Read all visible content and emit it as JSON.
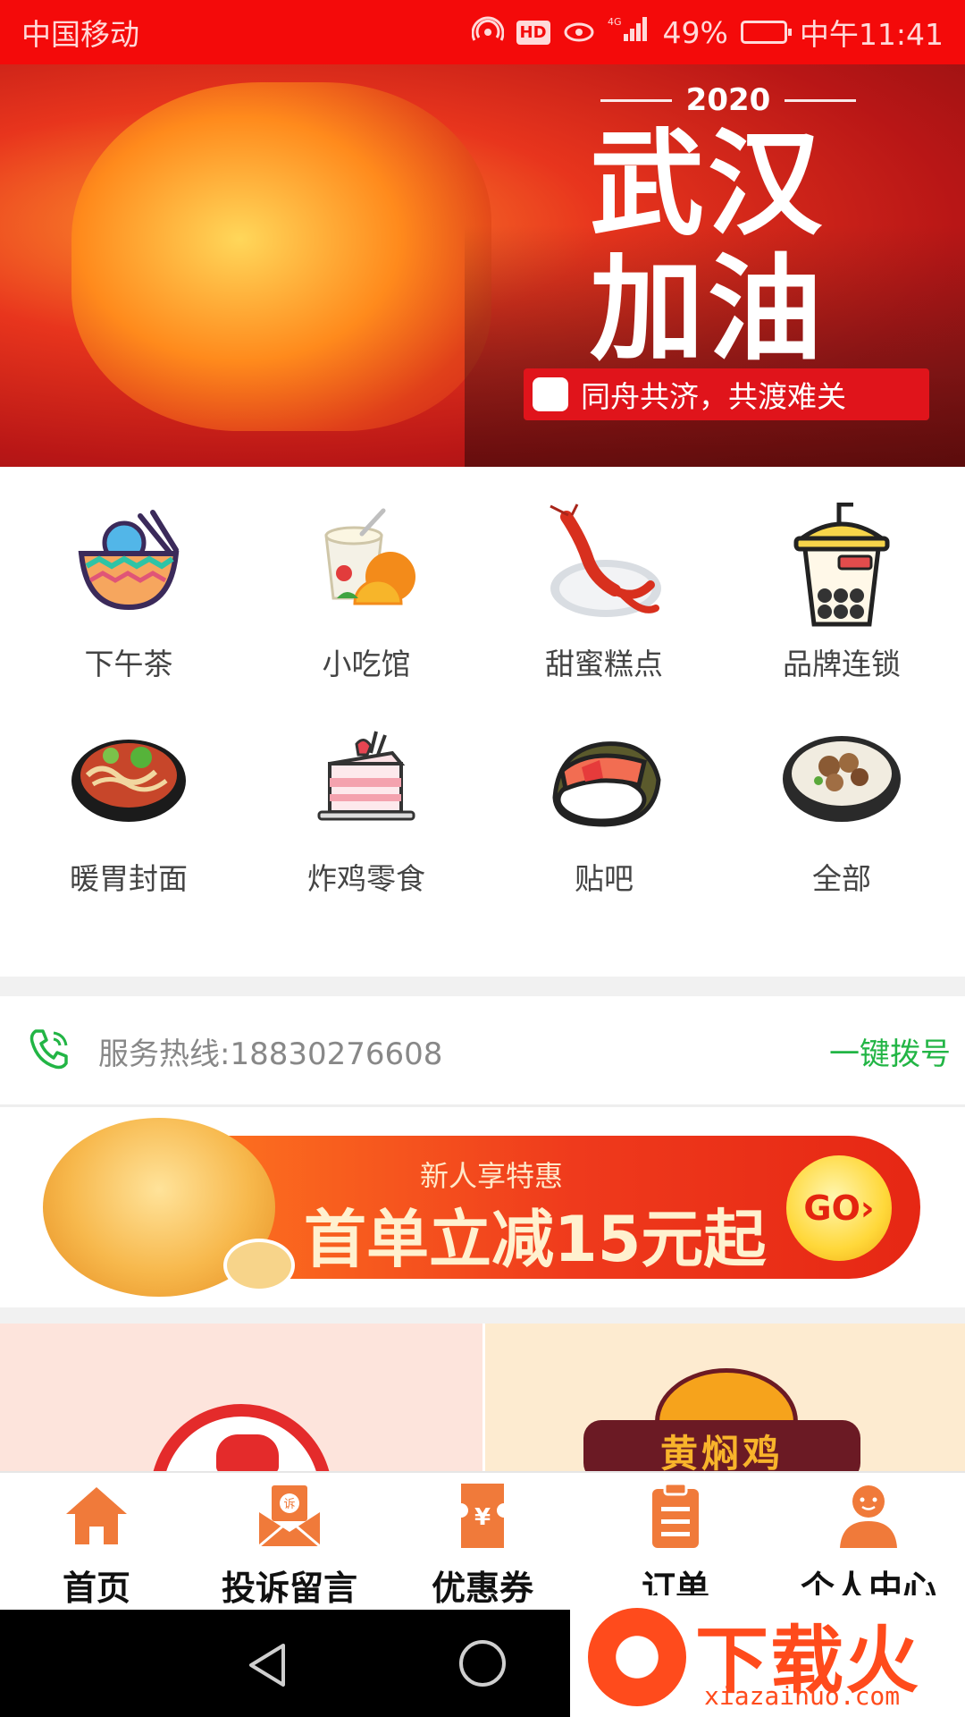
{
  "status_bar": {
    "carrier": "中国移动",
    "hd": "HD",
    "network": "4G",
    "battery": "49%",
    "time": "中午11:41"
  },
  "banner": {
    "year": "2020",
    "title_line1": "武汉",
    "title_line2": "加油",
    "slogan": "同舟共济，共渡难关",
    "slides": 3,
    "active_slide": 1
  },
  "categories": [
    {
      "label": "下午茶",
      "icon": "bowl-icon"
    },
    {
      "label": "小吃馆",
      "icon": "yogurt-icon"
    },
    {
      "label": "甜蜜糕点",
      "icon": "lobster-icon"
    },
    {
      "label": "品牌连锁",
      "icon": "bubble-tea-icon"
    },
    {
      "label": "暖胃封面",
      "icon": "noodle-bowl-icon"
    },
    {
      "label": "炸鸡零食",
      "icon": "cake-icon"
    },
    {
      "label": "贴吧",
      "icon": "sushi-icon"
    },
    {
      "label": "全部",
      "icon": "rice-bowl-icon"
    }
  ],
  "hotline": {
    "label": "服务热线:18830276608",
    "dial_label": "一键拨号",
    "accent": "#22b545"
  },
  "promo": {
    "subtitle": "新人享特惠",
    "headline": "首单立减15元起",
    "go": "GO›"
  },
  "shops": {
    "right_sign": "黄焖鸡"
  },
  "bottom_nav": [
    {
      "label": "首页",
      "icon": "home-icon"
    },
    {
      "label": "投诉留言",
      "icon": "complaint-icon"
    },
    {
      "label": "优惠券",
      "icon": "coupon-icon"
    },
    {
      "label": "订单",
      "icon": "clipboard-icon"
    },
    {
      "label": "个人中心",
      "icon": "person-icon"
    }
  ],
  "watermark": {
    "text": "下载火",
    "url": "xiazaihuo.com"
  },
  "colors": {
    "brand_red": "#f40a0a",
    "nav_orange": "#f07a3a"
  }
}
